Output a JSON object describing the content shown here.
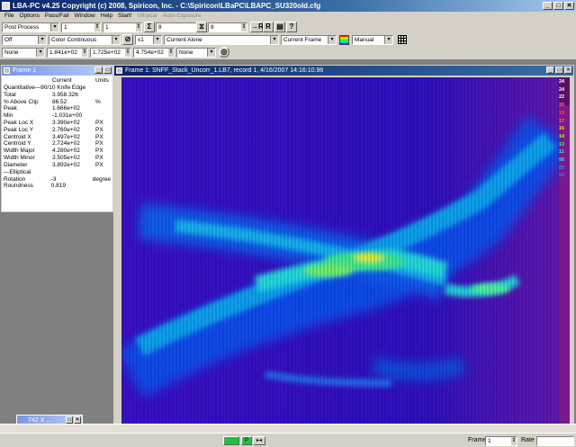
{
  "window": {
    "title": "LBA-PC    v4.25   Copyright (c) 2008, Spiricon, Inc.  - C:\\Spiricon\\LBaPC\\LBAPC_SU320old.cfg",
    "minimize": "_",
    "maximize": "□",
    "close": "✕"
  },
  "menu": {
    "items": [
      "File",
      "Options",
      "Pass/Fail",
      "Window",
      "Help",
      "Start!",
      "Ultracal",
      "Auto-Exposure"
    ]
  },
  "toolbar1": {
    "process": "Post Process",
    "spin1": "1",
    "spin2": "1",
    "sigma": "Σ",
    "spin3": "8",
    "spin4": "8",
    "btn_r1": "→R",
    "btn_r2": "R"
  },
  "toolbar2": {
    "mode": "Off",
    "palette_mode": "Color Continuous",
    "zoom": "x1",
    "display": "Current Alone",
    "frame": "Current Frame",
    "scale": "Manual"
  },
  "toolbar3": {
    "filter": "None",
    "val1": "1.841e+02",
    "val2": "1.725e+02",
    "val3": "4.754e+02",
    "filter2": "None"
  },
  "stats_window": {
    "title": "Frame 1",
    "col_current": "Current",
    "col_units": "Units",
    "section_quant": "Quantitative—90/10 Knife Edge",
    "rows": [
      {
        "label": "Total",
        "value": "3.958.326",
        "unit": ""
      },
      {
        "label": "% Above Clip",
        "value": "86.52",
        "unit": "%"
      },
      {
        "label": "Peak",
        "value": "1.666e+02",
        "unit": ""
      },
      {
        "label": "Min",
        "value": "-1.031e+00",
        "unit": ""
      },
      {
        "label": "Peak Loc X",
        "value": "3.390e+02",
        "unit": "PX"
      },
      {
        "label": "Peak Loc Y",
        "value": "2.760e+02",
        "unit": "PX"
      },
      {
        "label": "Centroid X",
        "value": "3.497e+02",
        "unit": "PX"
      },
      {
        "label": "Centroid Y",
        "value": "2.724e+02",
        "unit": "PX"
      },
      {
        "label": "Width Major",
        "value": "4.280e+02",
        "unit": "PX"
      },
      {
        "label": "Width Minor",
        "value": "3.505e+02",
        "unit": "PX"
      },
      {
        "label": "Diameter",
        "value": "3.892e+02",
        "unit": "PX"
      }
    ],
    "section_ellip": "Elliptical",
    "rows2": [
      {
        "label": "Rotation",
        "value": "-3",
        "unit": "degree"
      },
      {
        "label": "Roundness",
        "value": "0.819",
        "unit": ""
      }
    ]
  },
  "image_window": {
    "title": "Frame 1:  SNFF_Stack_Uncorr_1.LB7,  record 1,  4/16/2007 14:16:10.96",
    "colorbar_labels": [
      "24",
      "24",
      "22",
      "20",
      "19",
      "17",
      "16",
      "14",
      "13",
      "11",
      "98",
      "80",
      "64"
    ]
  },
  "minimized": {
    "title": "742 X ..."
  },
  "status": {
    "frame_label": "Frame",
    "frame_value": "1",
    "rate_label": "Rate",
    "btn_a": "",
    "btn_b": "P"
  }
}
